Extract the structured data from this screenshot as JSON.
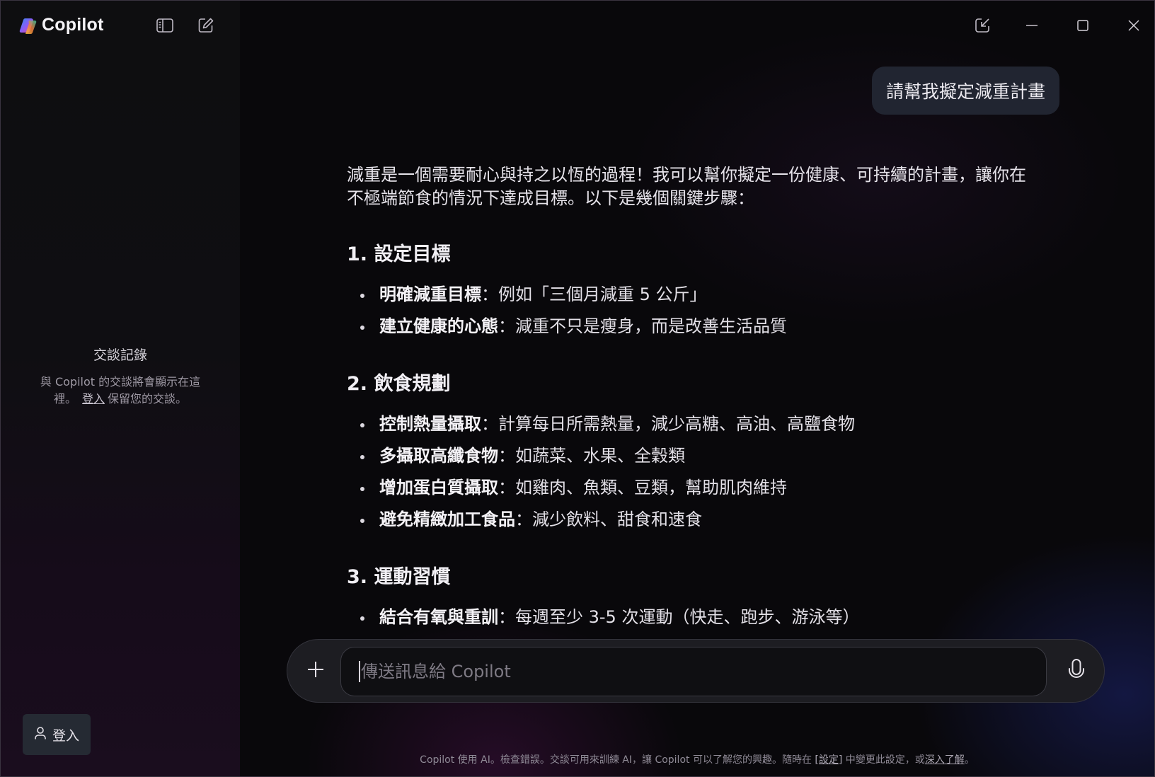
{
  "app": {
    "name": "Copilot"
  },
  "sidebar": {
    "history_title": "交談記錄",
    "history_desc_1": "與 Copilot 的交談將會顯示在這裡。",
    "history_login_link": "登入",
    "history_desc_2": "保留您的交談。",
    "signin_label": "登入"
  },
  "conversation": {
    "user_message": "請幫我擬定減重計畫",
    "answer": {
      "intro": "減重是一個需要耐心與持之以恆的過程！我可以幫你擬定一份健康、可持續的計畫，讓你在不極端節食的情況下達成目標。以下是幾個關鍵步驟：",
      "sections": [
        {
          "title": "1. 設定目標",
          "items": [
            {
              "bold": "明確減重目標",
              "text": "：例如「三個月減重 5 公斤」"
            },
            {
              "bold": "建立健康的心態",
              "text": "：減重不只是瘦身，而是改善生活品質"
            }
          ]
        },
        {
          "title": "2. 飲食規劃",
          "items": [
            {
              "bold": "控制熱量攝取",
              "text": "：計算每日所需熱量，減少高糖、高油、高鹽食物"
            },
            {
              "bold": "多攝取高纖食物",
              "text": "：如蔬菜、水果、全穀類"
            },
            {
              "bold": "增加蛋白質攝取",
              "text": "：如雞肉、魚類、豆類，幫助肌肉維持"
            },
            {
              "bold": "避免精緻加工食品",
              "text": "：減少飲料、甜食和速食"
            }
          ]
        },
        {
          "title": "3. 運動習慣",
          "items": [
            {
              "bold": "結合有氧與重訓",
              "text": "：每週至少 3-5 次運動（快走、跑步、游泳等）"
            }
          ]
        }
      ]
    }
  },
  "composer": {
    "placeholder": "傳送訊息給 Copilot"
  },
  "footer": {
    "text_1": "Copilot 使用 AI。檢查錯誤。交談可用來訓練 AI，讓 Copilot 可以了解您的興趣。隨時在 ",
    "settings_link": "[設定]",
    "text_2": " 中變更此設定，或",
    "learn_more_link": "深入了解",
    "text_3": "。"
  },
  "icons": {
    "sidebar_toggle": "sidebar-toggle-icon",
    "new_chat": "new-chat-icon",
    "popout": "popout-icon",
    "minimize": "minimize-icon",
    "maximize": "maximize-icon",
    "close": "close-icon",
    "plus": "plus-icon",
    "microphone": "microphone-icon",
    "user": "user-icon"
  }
}
